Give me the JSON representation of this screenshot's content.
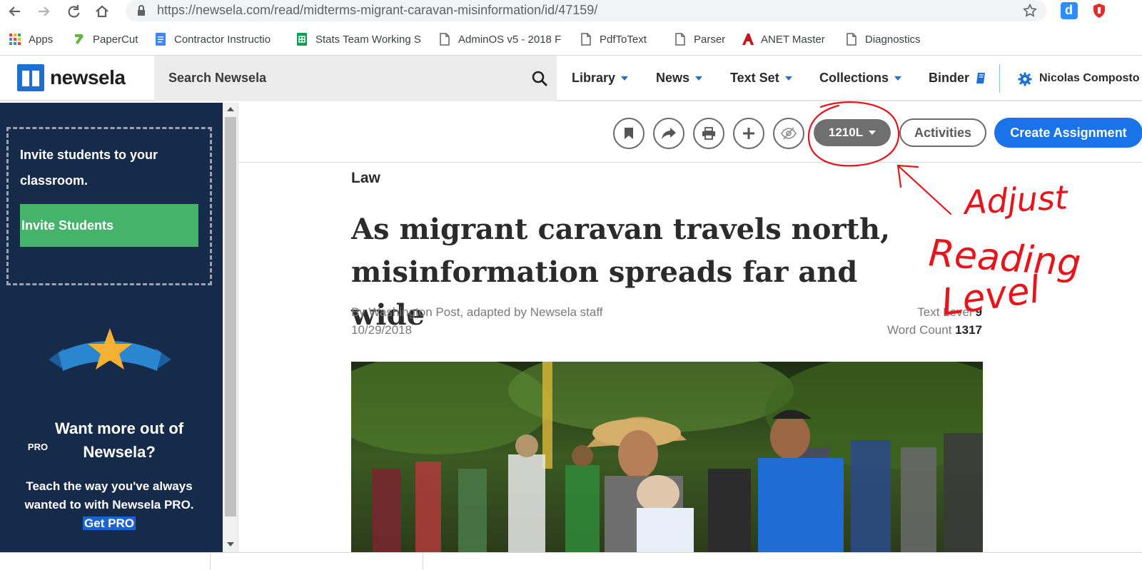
{
  "browser": {
    "url": "https://newsela.com/read/midterms-migrant-caravan-misinformation/id/47159/",
    "bookmarks": [
      {
        "label": "Apps",
        "icon": "apps-grid-icon"
      },
      {
        "label": "PaperCut",
        "icon": "papercut-icon"
      },
      {
        "label": "Contractor Instructio",
        "icon": "docs-icon"
      },
      {
        "label": "Stats Team Working S",
        "icon": "sheets-icon"
      },
      {
        "label": "AdminOS v5 - 2018 F",
        "icon": "page-icon"
      },
      {
        "label": "PdfToText",
        "icon": "page-icon"
      },
      {
        "label": "Parser",
        "icon": "page-icon"
      },
      {
        "label": "ANET Master",
        "icon": "acrobat-icon"
      },
      {
        "label": "Diagnostics",
        "icon": "page-icon"
      }
    ]
  },
  "header": {
    "logo": "newsela",
    "search_placeholder": "Search Newsela",
    "nav": [
      "Library",
      "News",
      "Text Set",
      "Collections",
      "Binder"
    ],
    "user": "Nicolas Composto"
  },
  "sidebar": {
    "invite_message": "Invite students to your classroom.",
    "invite_button": "Invite Students",
    "pro_sup": "PRO",
    "pro_title": "Want more out of Newsela?",
    "pro_body": "Teach the way you've always wanted to with Newsela PRO.",
    "pro_link": "Get PRO"
  },
  "toolbar": {
    "reading_level": "1210L",
    "activities": "Activities",
    "create_assignment": "Create Assignment",
    "icons": [
      "bookmark-icon",
      "share-icon",
      "print-icon",
      "add-icon",
      "hide-icon"
    ]
  },
  "article": {
    "topic": "Law",
    "title": "As migrant caravan travels north, misinformation spreads far and wide",
    "byline": "By Washington Post, adapted by Newsela staff",
    "date": "10/29/2018",
    "text_level_label": "Text Level",
    "text_level": "9",
    "word_count_label": "Word Count",
    "word_count": "1317"
  },
  "annotation": {
    "text_lines": [
      "Adjust",
      "Reading",
      "Level"
    ],
    "color": "#e8141b"
  },
  "colors": {
    "brand_blue": "#1a73e8",
    "sidebar_bg": "#162a4a",
    "invite_green": "#46b36a"
  }
}
